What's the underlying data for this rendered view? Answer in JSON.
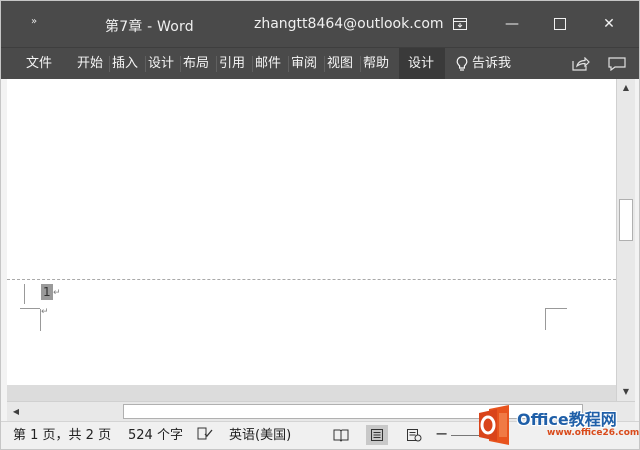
{
  "titlebar": {
    "quick_access": "»",
    "doc_title": "第7章  -  Word",
    "account": "zhangtt8464@outlook.com",
    "ribbon_display_icon": "ribbon-display-options-icon",
    "minimize_glyph": "—",
    "maximize_glyph": "☐",
    "close_glyph": "✕"
  },
  "ribbon": {
    "tabs": [
      {
        "label": "文件"
      },
      {
        "label": "开始"
      },
      {
        "label": "插入"
      },
      {
        "label": "设计"
      },
      {
        "label": "布局"
      },
      {
        "label": "引用"
      },
      {
        "label": "邮件"
      },
      {
        "label": "审阅"
      },
      {
        "label": "视图"
      },
      {
        "label": "帮助"
      },
      {
        "label": "设计",
        "active": true
      }
    ],
    "tell_me": "告诉我",
    "tell_me_icon": "lightbulb-icon",
    "share_icon": "share-icon",
    "comment_icon": "comment-icon"
  },
  "document": {
    "page_number_field": "1",
    "paragraph_mark": "↵"
  },
  "statusbar": {
    "pages": "第 1 页，共 2 页",
    "words": "524 个字",
    "language": "英语(美国)",
    "proofing_icon": "proofing-icon",
    "zoom_minus": "−"
  },
  "watermark": {
    "brand": "Office教程网",
    "site": "www.office26.com"
  },
  "colors": {
    "title_bar": "#4a4a4a",
    "ribbon_text": "#f5f5f5",
    "document_bg": "#ffffff",
    "status_bar": "#f0f0f0",
    "logo_orange": "#e8541e",
    "logo_blue": "#1f5fa8"
  }
}
